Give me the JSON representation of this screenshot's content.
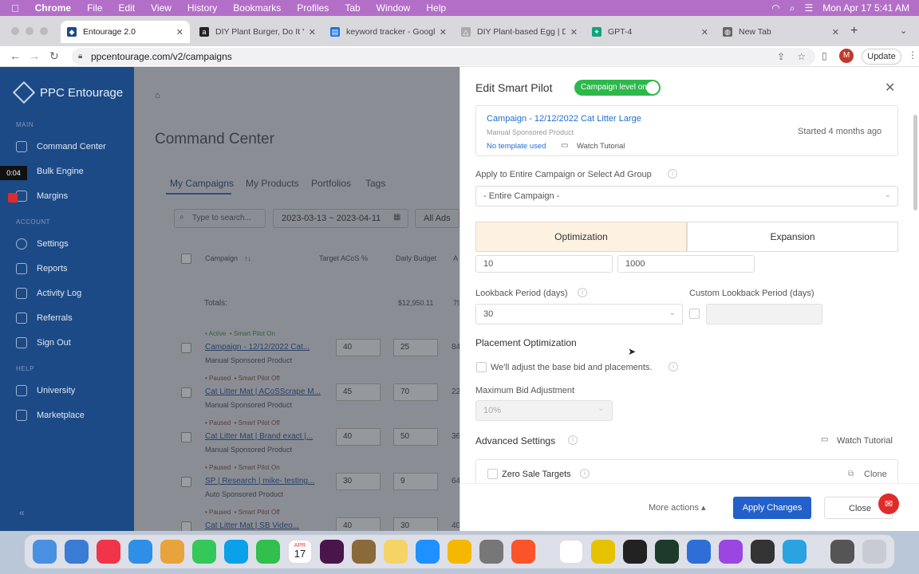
{
  "menubar": {
    "app": "Chrome",
    "items": [
      "File",
      "Edit",
      "View",
      "History",
      "Bookmarks",
      "Profiles",
      "Tab",
      "Window",
      "Help"
    ],
    "clock": "Mon Apr 17  5:41 AM"
  },
  "tabs": [
    {
      "label": "Entourage 2.0",
      "color": "#1c4a86"
    },
    {
      "label": "DIY Plant Burger, Do It Y",
      "color": "#222"
    },
    {
      "label": "keyword tracker - Googl",
      "color": "#1a73e8"
    },
    {
      "label": "DIY Plant-based Egg | Di",
      "color": "#aaa"
    },
    {
      "label": "GPT-4",
      "color": "#10a37f"
    },
    {
      "label": "New Tab",
      "color": "#666"
    }
  ],
  "browser": {
    "url": "ppcentourage.com/v2/campaigns",
    "update_label": "Update",
    "avatar": "M"
  },
  "sidebar": {
    "logo": "PPC Entourage",
    "main_label": "MAIN",
    "items": [
      "Command Center",
      "Bulk Engine",
      "Margins"
    ],
    "account_label": "ACCOUNT",
    "account_items": [
      "Settings",
      "Reports",
      "Activity Log",
      "Referrals",
      "Sign Out"
    ],
    "help_label": "HELP",
    "help_items": [
      "University",
      "Marketplace"
    ],
    "timer": "0:04"
  },
  "main": {
    "title": "Command Center",
    "tabs": [
      "My Campaigns",
      "My Products",
      "Portfolios",
      "Tags"
    ],
    "search_placeholder": "Type to search...",
    "date_range": "2023-03-13 ~ 2023-04-11",
    "filter": "All Ads",
    "columns": [
      "Campaign",
      "Target ACoS %",
      "Daily Budget",
      "A"
    ],
    "totals_label": "Totals:",
    "totals_budget": "$12,950.11",
    "totals_extra": "79",
    "rows": [
      {
        "status": "Active",
        "pilot": "Smart Pilot On",
        "name": "Campaign - 12/12/2022 Cat...",
        "type": "Manual   Sponsored Product",
        "acos": "40",
        "budget": "25",
        "extra": "84"
      },
      {
        "status": "Paused",
        "pilot": "Smart Pilot Off",
        "name": "Cat Litter Mat | ACoSScrape M...",
        "type": "Manual   Sponsored Product",
        "acos": "45",
        "budget": "70",
        "extra": "22"
      },
      {
        "status": "Paused",
        "pilot": "Smart Pilot Off",
        "name": "Cat Litter Mat | Brand exact |...",
        "type": "Manual   Sponsored Product",
        "acos": "40",
        "budget": "50",
        "extra": "36"
      },
      {
        "status": "Paused",
        "pilot": "Smart Pilot On",
        "name": "SP | Research | mike- testing...",
        "type": "Auto   Sponsored Product",
        "acos": "30",
        "budget": "9",
        "extra": "64"
      },
      {
        "status": "Paused",
        "pilot": "Smart Pilot Off",
        "name": "Cat Litter Mat | SB Video...",
        "type": "",
        "acos": "40",
        "budget": "30",
        "extra": "40"
      }
    ]
  },
  "panel": {
    "title": "Edit Smart Pilot",
    "toggle_label": "Campaign level on",
    "campaign_name": "Campaign - 12/12/2022 Cat Litter Large",
    "campaign_type": "Manual   Sponsored Product",
    "template": "No template used",
    "watch": "Watch Tutorial",
    "started": "Started 4 months ago",
    "apply_label": "Apply to Entire Campaign or Select Ad Group",
    "apply_value": "- Entire Campaign -",
    "tab_opt": "Optimization",
    "tab_exp": "Expansion",
    "val1": "10",
    "val2": "1000",
    "lookback_label": "Lookback Period (days)",
    "lookback_value": "30",
    "custom_label": "Custom Lookback Period (days)",
    "placement_title": "Placement Optimization",
    "placement_check": "We'll adjust the base bid and placements.",
    "max_bid_label": "Maximum Bid Adjustment",
    "max_bid_value": "10%",
    "advanced_title": "Advanced Settings",
    "watch2": "Watch Tutorial",
    "zero_sale": "Zero Sale Targets",
    "clone": "Clone",
    "more_actions": "More actions",
    "apply_btn": "Apply Changes",
    "close_btn": "Close"
  },
  "colors": {
    "sidebar": "#1c4a86",
    "accent": "#1f6fd0",
    "green": "#2db84b",
    "menubar": "#b36fc8",
    "apply": "#2360c9"
  },
  "dock": {
    "calendar_month": "APR",
    "calendar_day": "17"
  }
}
